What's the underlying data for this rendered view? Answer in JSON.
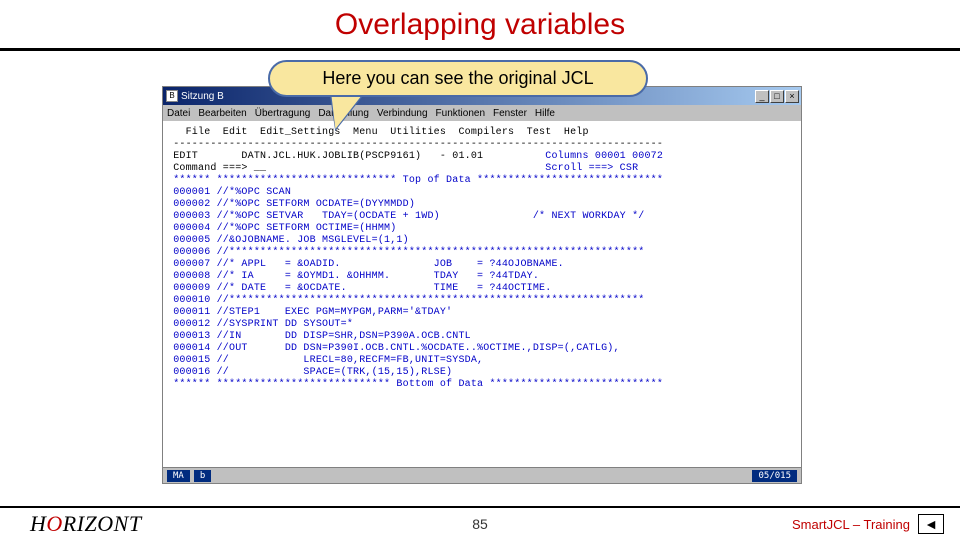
{
  "slide": {
    "title": "Overlapping variables",
    "callout": "Here you can see the original JCL",
    "page_number": "85"
  },
  "footer": {
    "brand_prefix": "H",
    "brand_o": "O",
    "brand_suffix": "RIZONT",
    "course": "SmartJCL – Training",
    "nav_icon": "◄"
  },
  "window": {
    "title": "Sitzung B",
    "menubar": [
      "Datei",
      "Bearbeiten",
      "Übertragung",
      "Darstellung",
      "Verbindung",
      "Funktionen",
      "Fenster",
      "Hilfe"
    ],
    "close": "×",
    "max": "□",
    "min": "_",
    "status_left": "MA",
    "status_mid": "b",
    "status_right": "05/015"
  },
  "editor": {
    "menu_row": "   File  Edit  Edit_Settings  Menu  Utilities  Compilers  Test  Help",
    "sep": " -------------------------------------------------------------------------------",
    "info_left": " EDIT       DATN.JCL.HUK.JOBLIB(PSCP9161)   - 01.01",
    "info_right": "Columns 00001 00072",
    "cmd_left": " Command ===> __",
    "cmd_right": "Scroll ===> CSR",
    "lines": [
      " ****** ***************************** Top of Data ******************************",
      " 000001 //*%OPC SCAN",
      " 000002 //*%OPC SETFORM OCDATE=(DYYMMDD)",
      " 000003 //*%OPC SETVAR   TDAY=(OCDATE + 1WD)               /* NEXT WORKDAY */",
      " 000004 //*%OPC SETFORM OCTIME=(HHMM)",
      " 000005 //&OJOBNAME. JOB MSGLEVEL=(1,1)",
      " 000006 //*******************************************************************",
      " 000007 //* APPL   = &OADID.               JOB    = ?44OJOBNAME.",
      " 000008 //* IA     = &OYMD1. &OHHMM.       TDAY   = ?44TDAY.",
      " 000009 //* DATE   = &OCDATE.              TIME   = ?44OCTIME.",
      " 000010 //*******************************************************************",
      " 000011 //STEP1    EXEC PGM=MYPGM,PARM='&TDAY'",
      " 000012 //SYSPRINT DD SYSOUT=*",
      " 000013 //IN       DD DISP=SHR,DSN=P390A.OCB.CNTL",
      " 000014 //OUT      DD DSN=P390I.OCB.CNTL.%OCDATE..%OCTIME.,DISP=(,CATLG),",
      " 000015 //            LRECL=80,RECFM=FB,UNIT=SYSDA,",
      " 000016 //            SPACE=(TRK,(15,15),RLSE)",
      " ****** **************************** Bottom of Data ****************************"
    ]
  }
}
